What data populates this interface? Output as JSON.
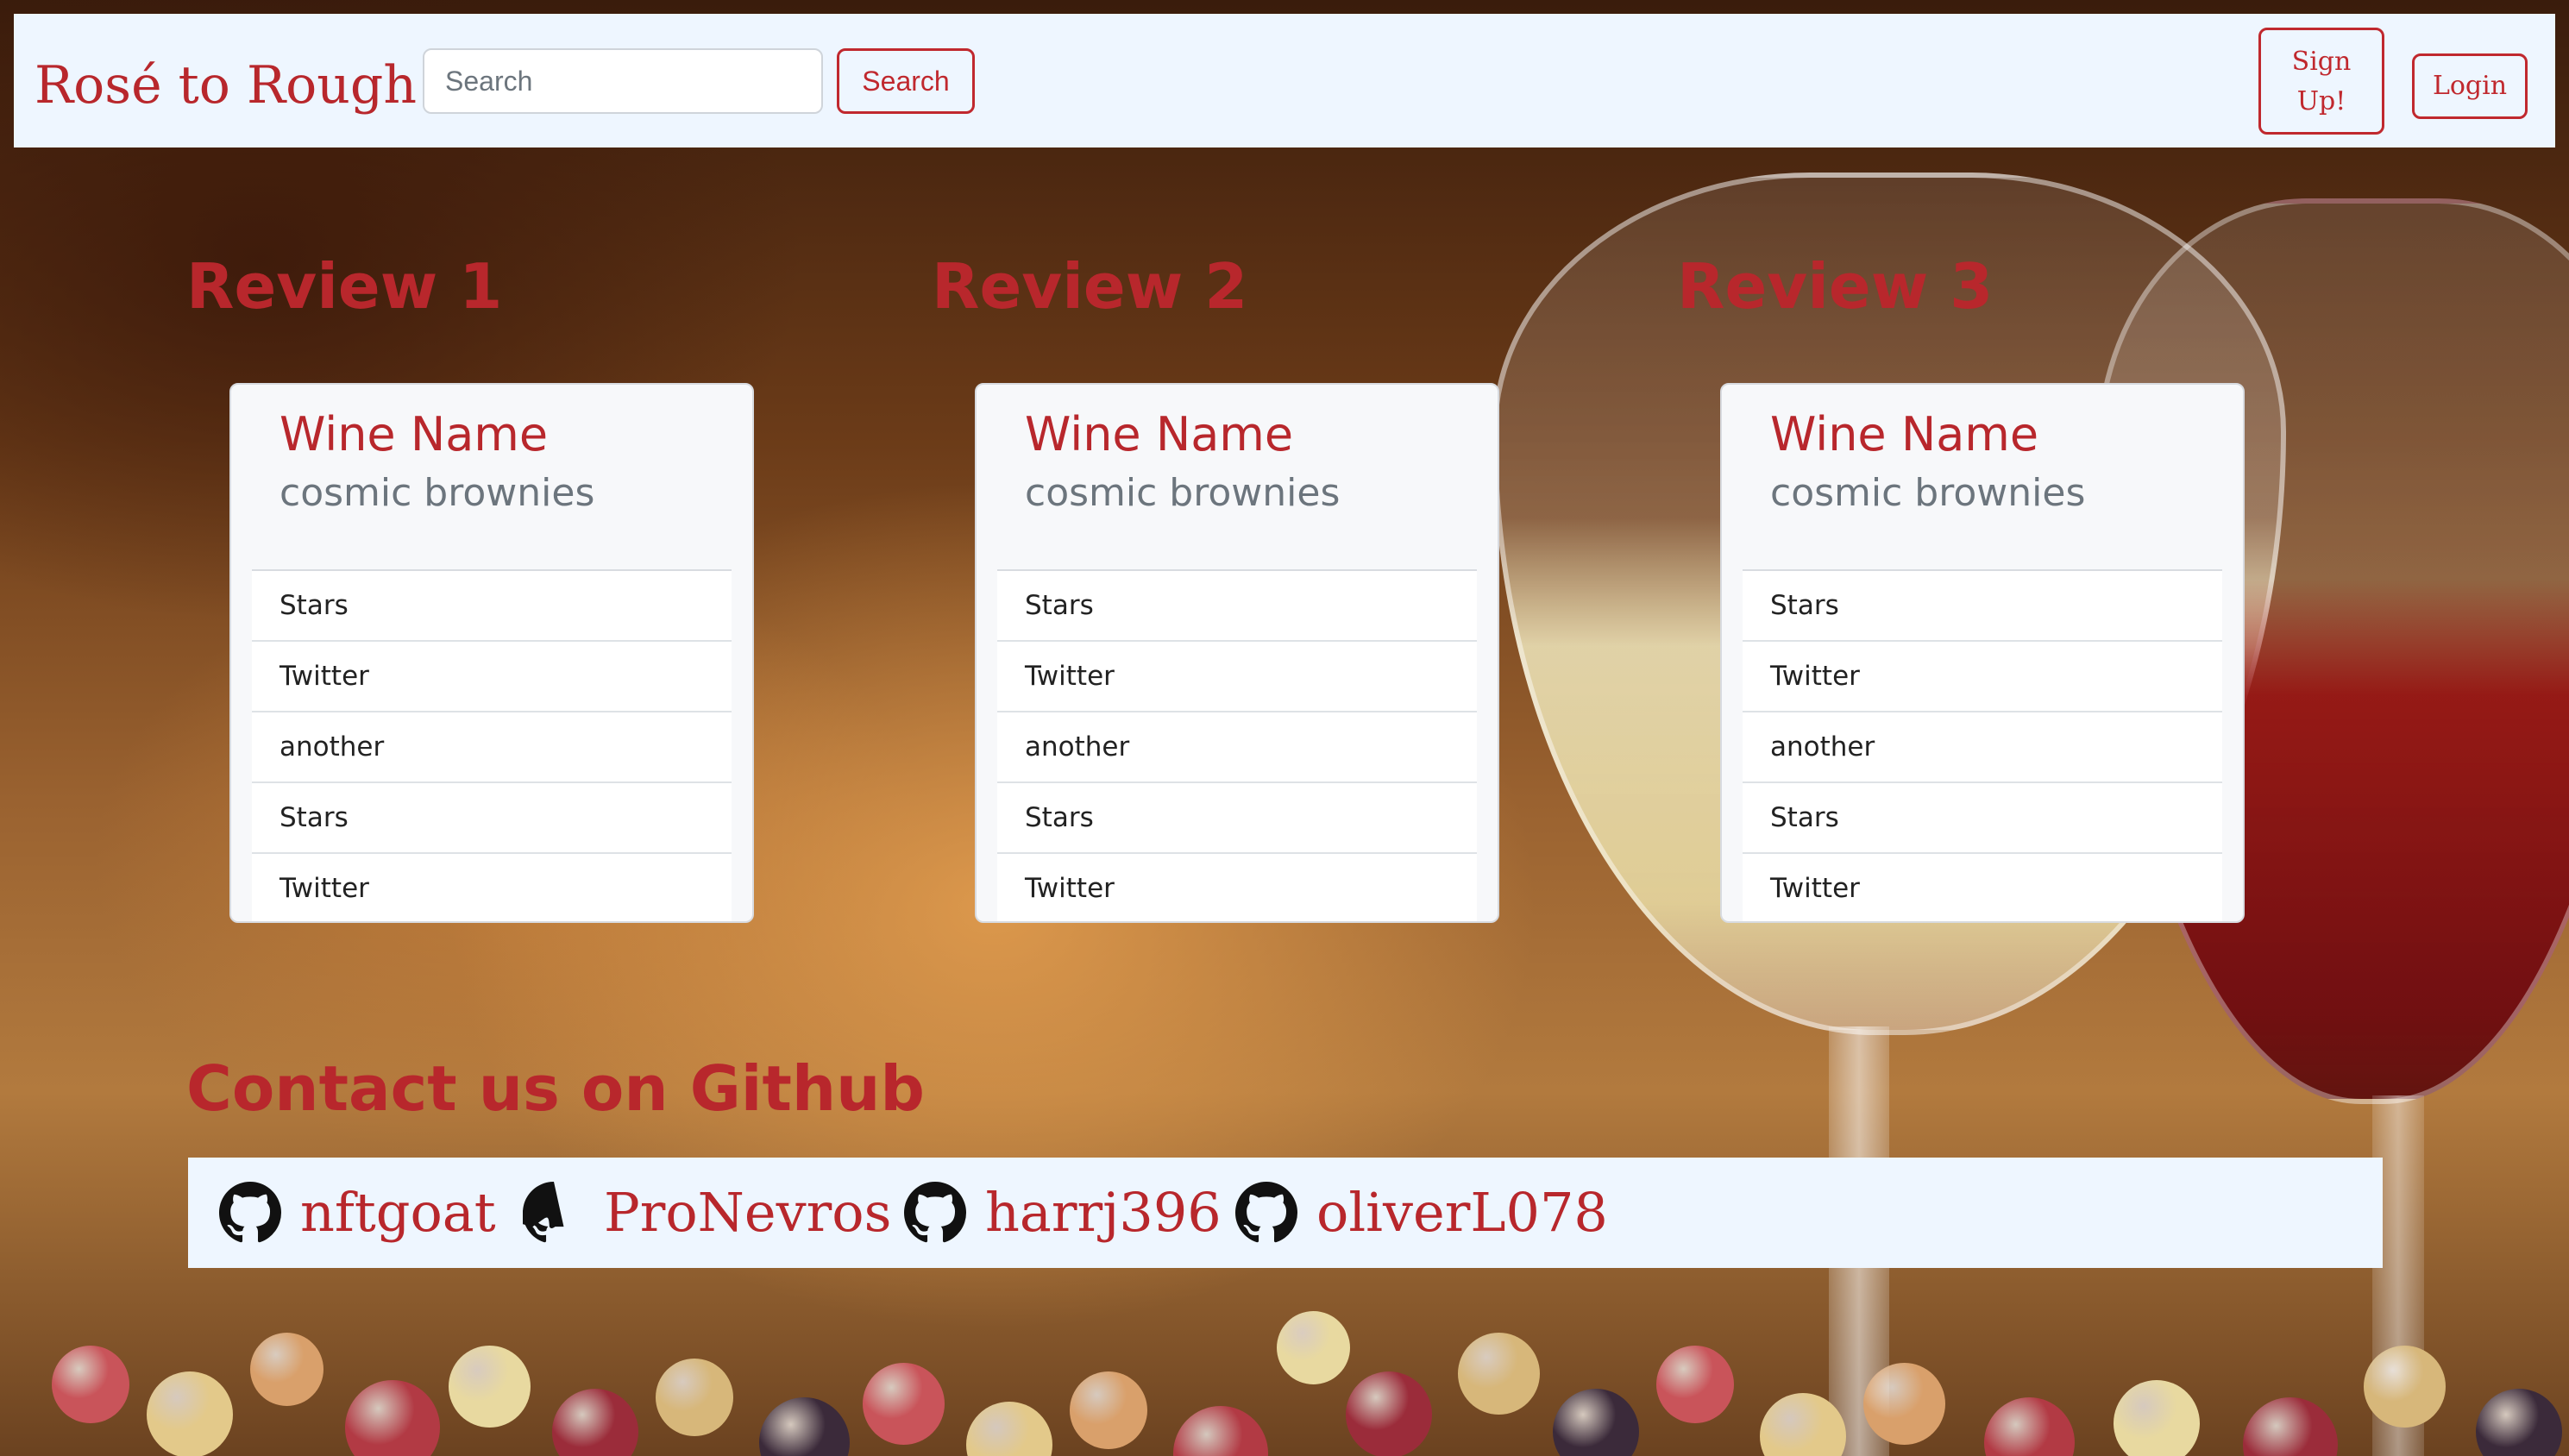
{
  "navbar": {
    "brand": "Rosé to Rough",
    "search_placeholder": "Search",
    "search_button": "Search",
    "signup_line1": "Sign",
    "signup_line2": "Up!",
    "login_button": "Login"
  },
  "reviews": [
    {
      "heading": "Review 1",
      "card_title": "Wine Name",
      "card_subtitle": "cosmic brownies",
      "items": [
        "Stars",
        "Twitter",
        "another",
        "Stars",
        "Twitter"
      ]
    },
    {
      "heading": "Review 2",
      "card_title": "Wine Name",
      "card_subtitle": "cosmic brownies",
      "items": [
        "Stars",
        "Twitter",
        "another",
        "Stars",
        "Twitter"
      ]
    },
    {
      "heading": "Review 3",
      "card_title": "Wine Name",
      "card_subtitle": "cosmic brownies",
      "items": [
        "Stars",
        "Twitter",
        "another",
        "Stars",
        "Twitter"
      ]
    }
  ],
  "contact": {
    "heading": "Contact us on Github",
    "users": [
      "nftgoat",
      "ProNevros",
      "harrj396",
      "oliverL078"
    ],
    "icon": "github-icon"
  },
  "colors": {
    "accent": "#b8272c",
    "navbar_bg": "#eef6ff"
  }
}
